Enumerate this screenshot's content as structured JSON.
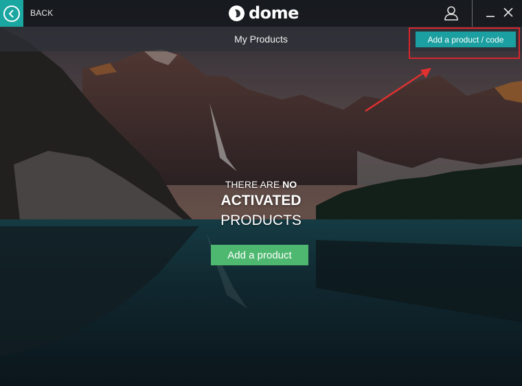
{
  "titlebar": {
    "back_label": "BACK",
    "logo_text": "dome",
    "icons": [
      "back-arrow-icon",
      "dome-logo-icon",
      "user-icon",
      "minimize-icon",
      "close-icon"
    ]
  },
  "header": {
    "title": "My Products"
  },
  "actions": {
    "add_code_label": "Add a product / code",
    "add_product_label": "Add a product"
  },
  "empty_state": {
    "line1_prefix": "THERE ARE",
    "line1_emphasis": "NO",
    "line2": "ACTIVATED",
    "line3": "PRODUCTS"
  },
  "colors": {
    "accent_teal": "#1aa6a1",
    "add_code_button": "#1b9fa0",
    "add_product_button": "#4fb870",
    "highlight_red": "#d9262c"
  }
}
